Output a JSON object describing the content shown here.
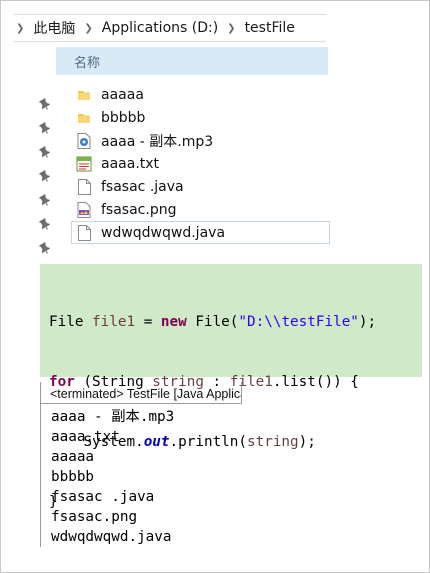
{
  "breadcrumb": {
    "items": [
      "此电脑",
      "Applications (D:)",
      "testFile"
    ]
  },
  "explorer": {
    "column_header": "名称",
    "files": [
      {
        "name": "aaaaa",
        "icon": "folder-icon"
      },
      {
        "name": "bbbbb",
        "icon": "folder-icon"
      },
      {
        "name": "aaaa - 副本.mp3",
        "icon": "audio-file-icon"
      },
      {
        "name": "aaaa.txt",
        "icon": "text-file-icon"
      },
      {
        "name": "fsasac .java",
        "icon": "blank-file-icon"
      },
      {
        "name": "fsasac.png",
        "icon": "image-file-icon"
      },
      {
        "name": "wdwqdwqwd.java",
        "icon": "blank-file-icon",
        "selected": true
      }
    ]
  },
  "code": {
    "line1": {
      "t1": "File ",
      "var": "file1",
      "t2": " = ",
      "kw": "new",
      "t3": " File(",
      "str": "\"D:\\\\testFile\"",
      "t4": ");"
    },
    "line2": {
      "kw": "for",
      "t1": " (String ",
      "var": "string",
      "t2": " : ",
      "var2": "file1",
      "t3": ".list()) {"
    },
    "line3": {
      "indent": "    ",
      "t1": "System.",
      "field": "out",
      "t2": ".println(",
      "var": "string",
      "t3": ");"
    },
    "line4": {
      "t1": "}"
    }
  },
  "console": {
    "tab_label": "<terminated> TestFile [Java Application]",
    "output": [
      "aaaa - 副本.mp3",
      "aaaa.txt",
      "aaaaa",
      "bbbbb",
      "fsasac .java",
      "fsasac.png",
      "wdwqdwqwd.java"
    ]
  },
  "colors": {
    "code_background": "#cfe9c9",
    "header_background": "#d9eaf7",
    "keyword": "#7f0055",
    "string": "#2a00ff",
    "local_variable": "#6a3e3e",
    "static_field": "#0000c0",
    "folder": "#f2c54b"
  }
}
